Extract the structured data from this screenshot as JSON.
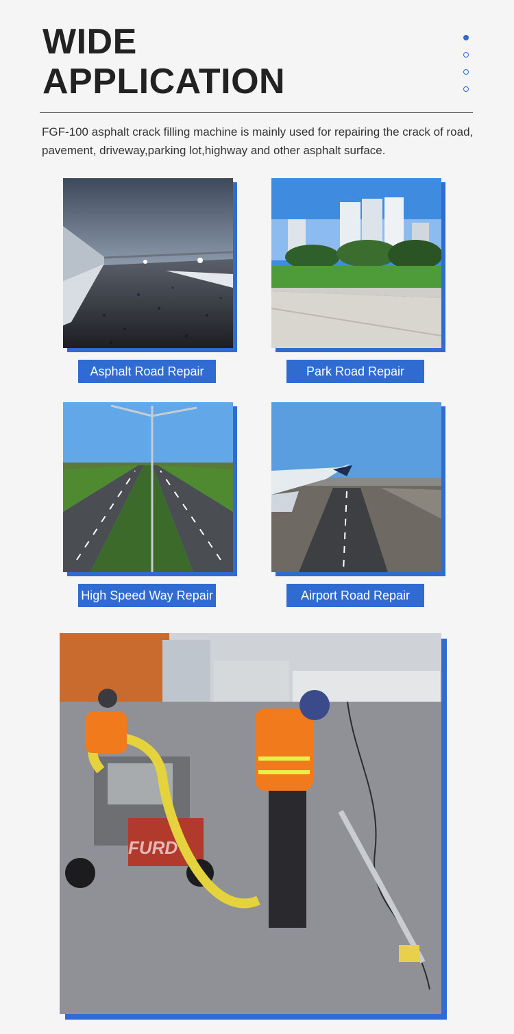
{
  "header": {
    "title_line1": "WIDE",
    "title_line2": "APPLICATION",
    "description": "FGF-100 asphalt crack filling machine is mainly used for repairing the crack of road, pavement, driveway,parking lot,highway and other asphalt surface."
  },
  "colors": {
    "accent": "#2f6bd0",
    "title": "#222222",
    "text": "#333333"
  },
  "pager": {
    "count": 4,
    "active_index": 0
  },
  "applications": [
    {
      "label": "Asphalt Road Repair",
      "image": "asphalt-road-photo"
    },
    {
      "label": "Park Road Repair",
      "image": "park-road-photo"
    },
    {
      "label": "High Speed Way Repair",
      "image": "highway-photo"
    },
    {
      "label": "Airport Road Repair",
      "image": "airport-runway-photo"
    }
  ],
  "feature_image": {
    "image": "workers-crack-filling-photo",
    "watermark": "FURD"
  }
}
